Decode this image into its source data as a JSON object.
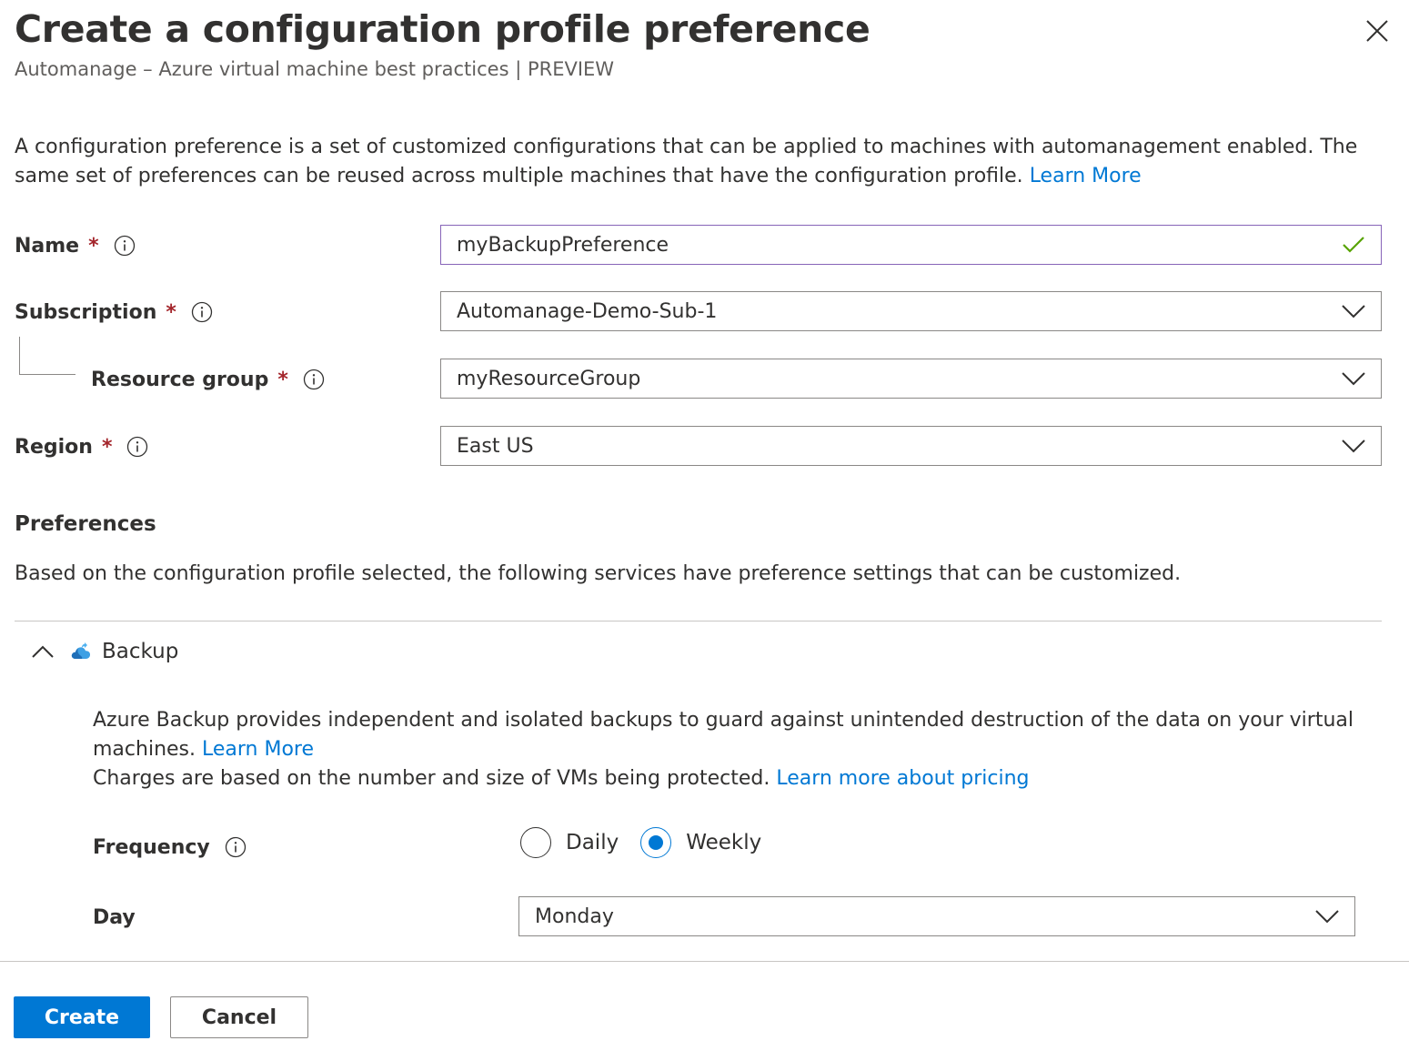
{
  "header": {
    "title": "Create a configuration profile preference",
    "subtitle": "Automanage – Azure virtual machine best practices | PREVIEW"
  },
  "intro": {
    "text": "A configuration preference is a set of customized configurations that can be applied to machines with automanagement enabled. The same set of preferences can be reused across multiple machines that have the configuration profile.",
    "link": "Learn More"
  },
  "form": {
    "required_marker": "*",
    "name": {
      "label": "Name",
      "value": "myBackupPreference"
    },
    "subscription": {
      "label": "Subscription",
      "value": "Automanage-Demo-Sub-1"
    },
    "resource_group": {
      "label": "Resource group",
      "value": "myResourceGroup"
    },
    "region": {
      "label": "Region",
      "value": "East US"
    }
  },
  "preferences": {
    "heading": "Preferences",
    "description": "Based on the configuration profile selected, the following services have preference settings that can be customized."
  },
  "backup": {
    "title": "Backup",
    "description": "Azure Backup provides independent and isolated backups to guard against unintended destruction of the data on your virtual machines.",
    "learn_more": "Learn More",
    "charges": "Charges are based on the number and size of VMs being protected.",
    "pricing_link": "Learn more about pricing",
    "frequency": {
      "label": "Frequency",
      "options": [
        "Daily",
        "Weekly"
      ],
      "selected": "Weekly"
    },
    "day": {
      "label": "Day",
      "value": "Monday"
    }
  },
  "footer": {
    "create_label": "Create",
    "cancel_label": "Cancel"
  },
  "colors": {
    "accent": "#0078d4",
    "required": "#a4262c",
    "valid_check": "#57a300",
    "focus_border": "#8764b8"
  },
  "icons": {
    "close": "close-icon",
    "info": "info-icon",
    "valid": "checkmark-icon",
    "dropdown": "chevron-down-icon",
    "collapse": "chevron-up-icon",
    "service": "backup-cloud-icon"
  }
}
